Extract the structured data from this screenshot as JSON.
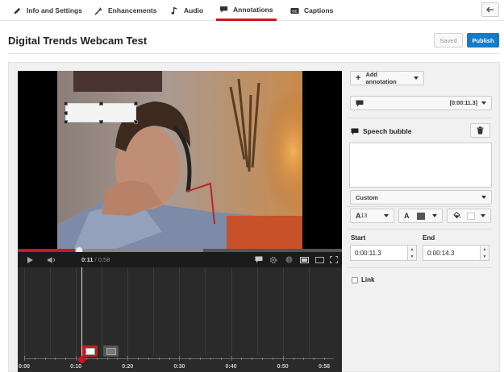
{
  "tabs": [
    {
      "label": "Info and Settings",
      "icon": "pencil-icon"
    },
    {
      "label": "Enhancements",
      "icon": "magic-wand-icon"
    },
    {
      "label": "Audio",
      "icon": "music-note-icon"
    },
    {
      "label": "Annotations",
      "icon": "speech-bubble-icon",
      "active": true
    },
    {
      "label": "Captions",
      "icon": "cc-icon"
    }
  ],
  "header": {
    "title": "Digital Trends Webcam Test",
    "saved_label": "Saved",
    "publish_label": "Publish"
  },
  "player": {
    "current_time": "0:11",
    "duration": "/ 0:58",
    "progress_fraction": 0.19
  },
  "timeline": {
    "labels": [
      "0:00",
      "0:10",
      "0:20",
      "0:30",
      "0:40",
      "0:50",
      "0:58"
    ]
  },
  "panel": {
    "add_annotation_label": "Add annotation",
    "annotation_time": "[0:00:11.3]",
    "annotation_type": "Speech bubble",
    "style_value": "Custom",
    "font_size": "13",
    "start_label": "Start",
    "end_label": "End",
    "start_value": "0:00:11.3",
    "end_value": "0:00:14.3",
    "link_label": "Link"
  },
  "colors": {
    "accent_red": "#cc181e",
    "publish_blue": "#167ac6"
  }
}
